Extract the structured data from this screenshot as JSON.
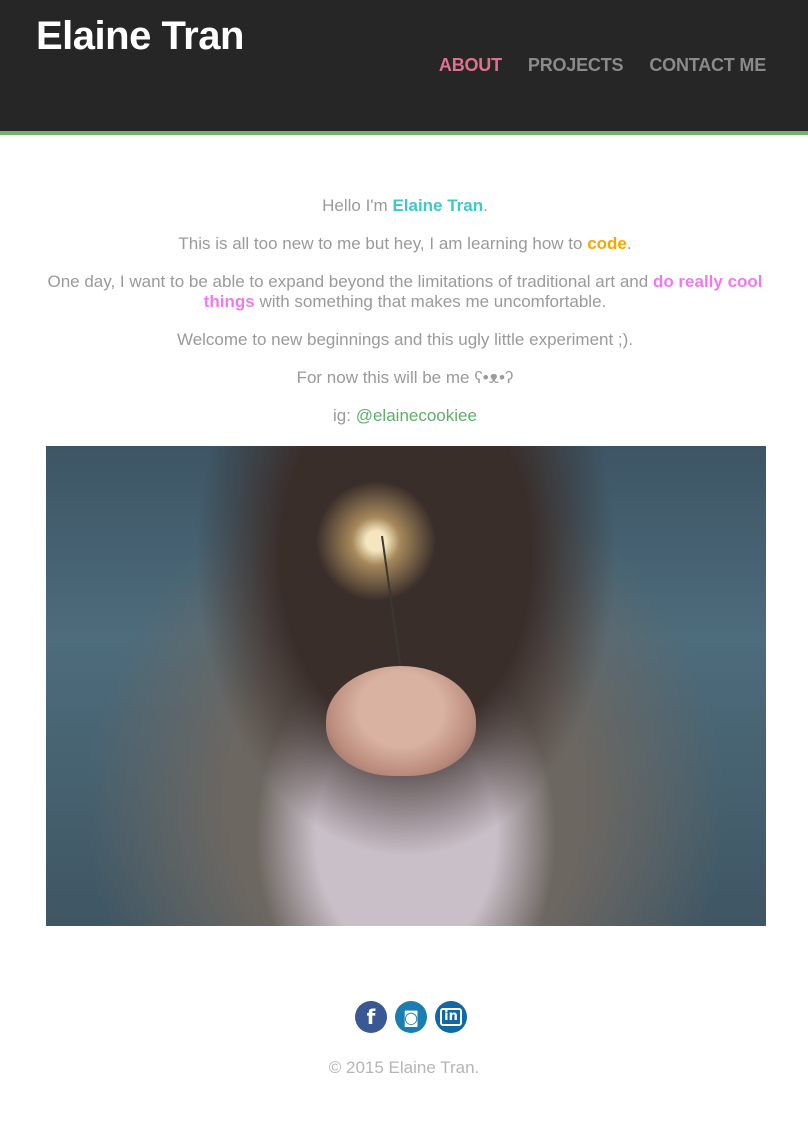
{
  "header": {
    "title": "Elaine Tran",
    "nav": [
      {
        "label": "ABOUT",
        "active": true
      },
      {
        "label": "PROJECTS",
        "active": false
      },
      {
        "label": "CONTACT ME",
        "active": false
      }
    ]
  },
  "intro": {
    "line1_pre": "Hello I'm ",
    "line1_name": "Elaine Tran",
    "line1_post": ".",
    "line2_pre": "This is all too new to me but hey, I am learning how to ",
    "line2_hl": "code",
    "line2_post": ".",
    "line3_pre": "One day, I want to be able to expand beyond the limitations of traditional art and ",
    "line3_hl": "do really cool things",
    "line3_post": " with something that makes me uncomfortable.",
    "line4": "Welcome to new beginnings and this ugly little experiment ;).",
    "line5": "For now this will be me ʕ•ᴥ•ʔ",
    "ig_label": "ig: ",
    "ig_handle": "@elainecookiee"
  },
  "social": [
    {
      "name": "facebook-icon",
      "glyph": "f"
    },
    {
      "name": "instagram-icon",
      "glyph": "◙"
    },
    {
      "name": "linkedin-icon",
      "glyph": "in"
    }
  ],
  "footer": {
    "copyright": "© 2015 Elaine Tran."
  },
  "colors": {
    "header_bg": "#262626",
    "header_border": "#6fb36f",
    "nav_active": "#e0708f",
    "name_teal": "#3ec8c8",
    "code_orange": "#f5a800",
    "cool_pink": "#ee7bee",
    "ig_green": "#5fae6a"
  }
}
